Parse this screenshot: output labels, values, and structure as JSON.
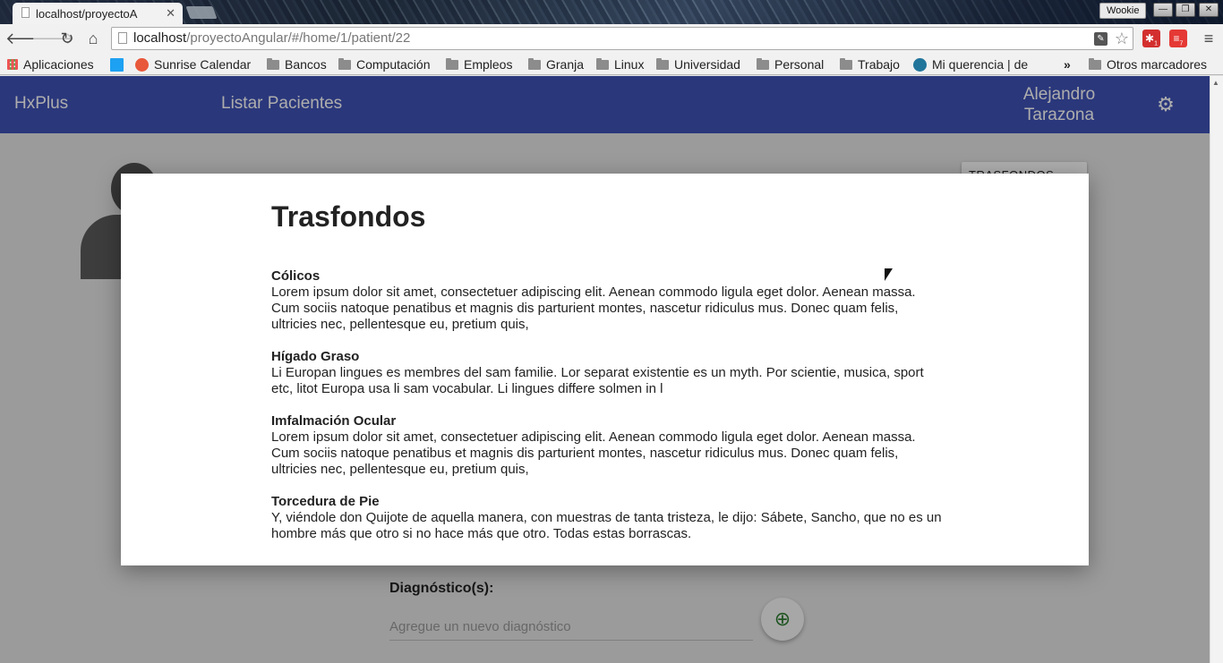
{
  "browser": {
    "tab_title": "localhost/proyectoA",
    "profile": "Wookie",
    "url_host": "localhost",
    "url_path": "/proyectoAngular/#/home/1/patient/22",
    "bookmarks": [
      "Aplicaciones",
      "Sunrise Calendar",
      "Bancos",
      "Computación",
      "Empleos",
      "Granja",
      "Linux",
      "Universidad",
      "Personal",
      "Trabajo",
      "Mi querencia | de"
    ],
    "other_bookmarks": "Otros marcadores",
    "ext_badges": [
      "1",
      "7"
    ]
  },
  "app": {
    "brand": "HxPlus",
    "nav_link": "Listar Pacientes",
    "user_name": "Alejandro Tarazona",
    "backgrounds_chip": "TRASFONDOS"
  },
  "diagnosis": {
    "label": "Diagnóstico(s):",
    "placeholder": "Agregue un nuevo diagnóstico"
  },
  "modal": {
    "title": "Trasfondos",
    "entries": [
      {
        "name": "Cólicos",
        "text": "Lorem ipsum dolor sit amet, consectetuer adipiscing elit. Aenean commodo ligula eget dolor. Aenean massa. Cum sociis natoque penatibus et magnis dis parturient montes, nascetur ridiculus mus. Donec quam felis, ultricies nec, pellentesque eu, pretium quis,"
      },
      {
        "name": "Hígado Graso",
        "text": "Li Europan lingues es membres del sam familie. Lor separat existentie es un myth. Por scientie, musica, sport etc, litot Europa usa li sam vocabular. Li lingues differe solmen in l"
      },
      {
        "name": "Imfalmación Ocular",
        "text": "Lorem ipsum dolor sit amet, consectetuer adipiscing elit. Aenean commodo ligula eget dolor. Aenean massa. Cum sociis natoque penatibus et magnis dis parturient montes, nascetur ridiculus mus. Donec quam felis, ultricies nec, pellentesque eu, pretium quis,"
      },
      {
        "name": "Torcedura de Pie",
        "text": "Y, viéndole don Quijote de aquella manera, con muestras de tanta tristeza, le dijo: Sábete, Sancho, que no es un hombre más que otro si no hace más que otro. Todas estas borrascas."
      }
    ]
  },
  "colors": {
    "appbar": "#3f51b5",
    "add_icon": "#2e7d32"
  }
}
